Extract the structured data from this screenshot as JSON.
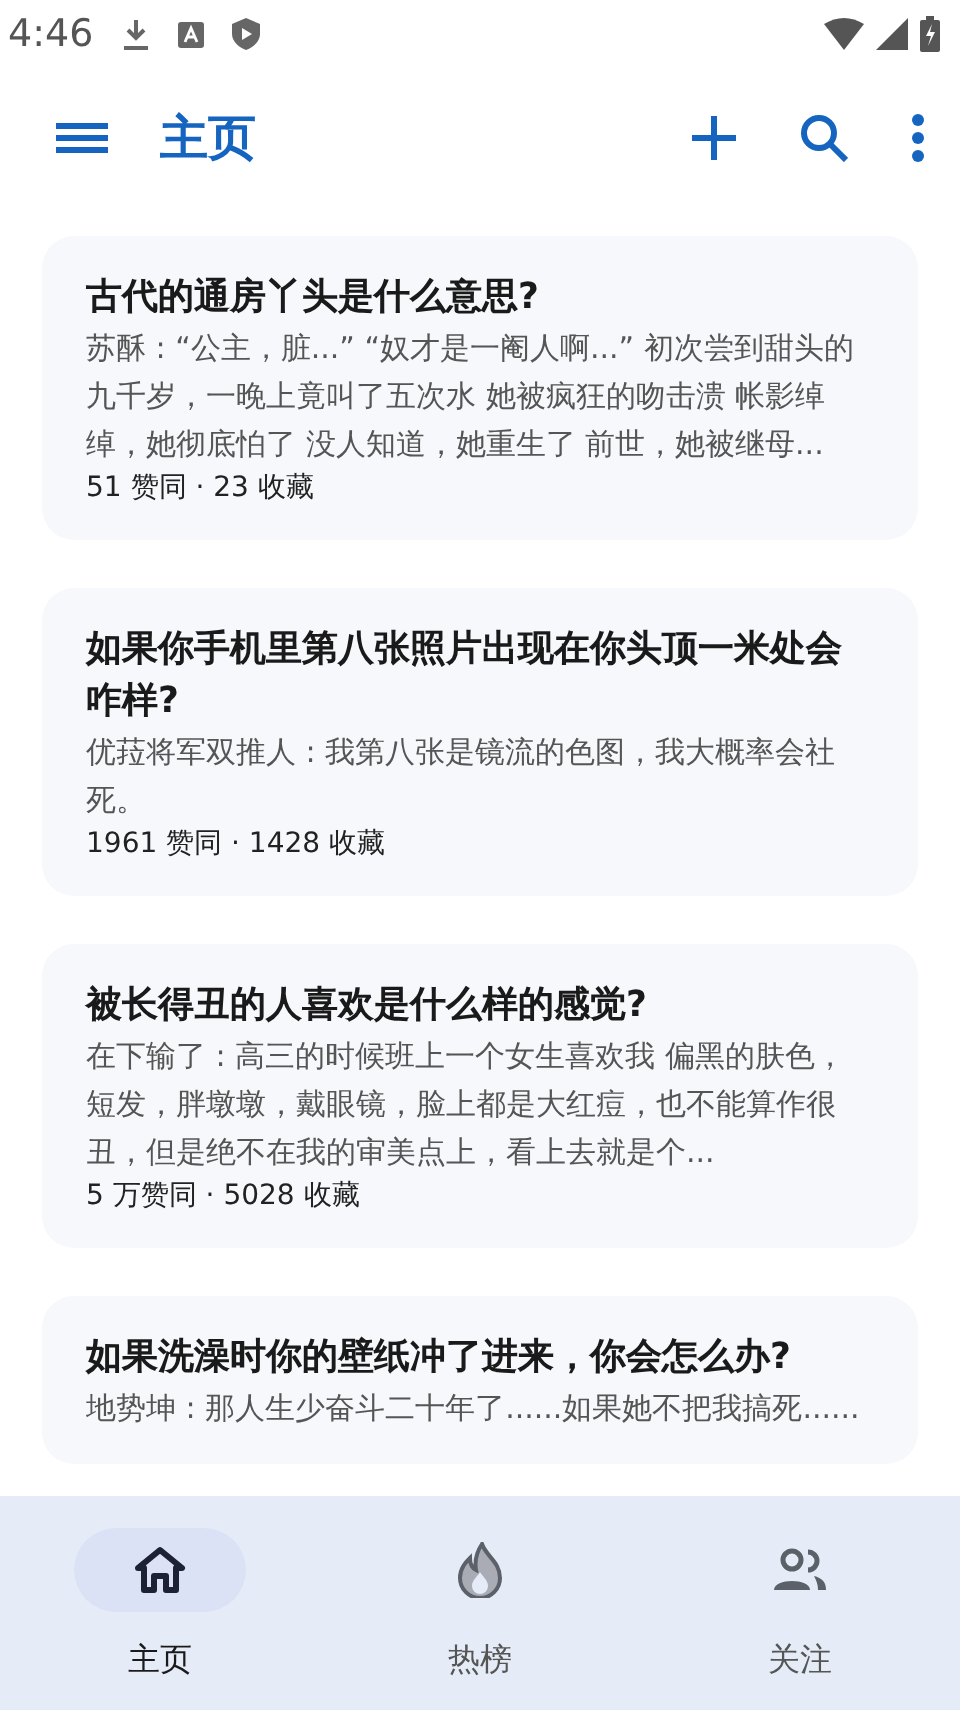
{
  "status_bar": {
    "time": "4:46"
  },
  "app_bar": {
    "title": "主页"
  },
  "feed": [
    {
      "title": "古代的通房丫头是什么意思?",
      "excerpt": "苏酥 : “公主，脏...” “奴才是一阉人啊...” 初次尝到甜头的九千岁，一晚上竟叫了五次水 她被疯狂的吻击溃 帐影绰绰，她彻底怕了 没人知道，她重生了 前世，她被继母...",
      "stats": "51 赞同 · 23 收藏"
    },
    {
      "title": "如果你手机里第八张照片出现在你头顶一米处会咋样?",
      "excerpt": "优菈将军双推人 : 我第八张是镜流的色图，我大概率会社死。",
      "stats": "1961 赞同 · 1428 收藏"
    },
    {
      "title": "被长得丑的人喜欢是什么样的感觉?",
      "excerpt": "在下输了 : 高三的时候班上一个女生喜欢我 偏黑的肤色，短发，胖墩墩，戴眼镜，脸上都是大红痘，也不能算作很丑，但是绝不在我的审美点上，看上去就是个...",
      "stats": "5 万赞同 · 5028 收藏"
    },
    {
      "title": "如果洗澡时你的壁纸冲了进来，你会怎么办?",
      "excerpt": "地势坤 : 那人生少奋斗二十年了......如果她不把我搞死......"
    }
  ],
  "bottom_nav": [
    {
      "kind": "home",
      "label": "主页",
      "selected": true
    },
    {
      "kind": "hot",
      "label": "热榜",
      "selected": false
    },
    {
      "kind": "follow",
      "label": "关注",
      "selected": false
    }
  ]
}
